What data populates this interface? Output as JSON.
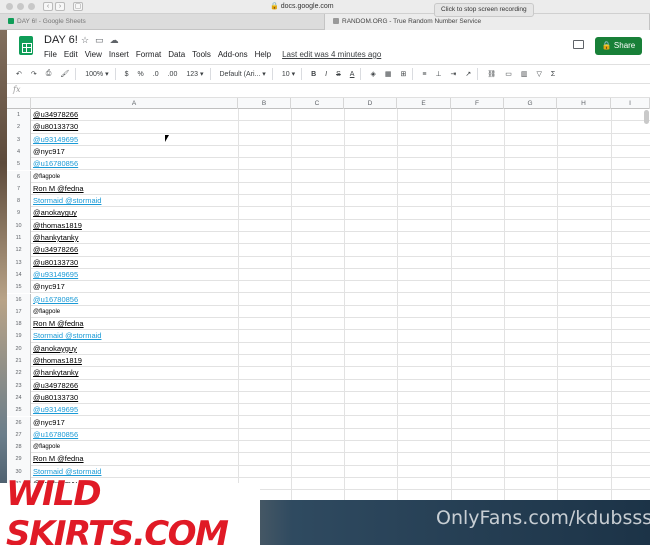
{
  "browser": {
    "url": "docs.google.com",
    "recording_notice": "Click  to stop screen recording",
    "tabs": [
      {
        "label": "DAY 6! - Google Sheets",
        "active": false
      },
      {
        "label": "RANDOM.ORG - True Random Number Service",
        "active": true
      }
    ]
  },
  "sheets": {
    "doc_title": "DAY 6!",
    "menu": [
      "File",
      "Edit",
      "View",
      "Insert",
      "Format",
      "Data",
      "Tools",
      "Add-ons",
      "Help"
    ],
    "last_edit": "Last edit was 4 minutes ago",
    "share_label": "Share",
    "toolbar": {
      "zoom": "100%",
      "currency": "$",
      "percent": "%",
      "dec_decrease": ".0",
      "dec_increase": ".00",
      "more_formats": "123",
      "font": "Default (Ari...",
      "font_size": "10",
      "bold": "B",
      "italic": "I",
      "strike": "S",
      "text_color": "A"
    },
    "fx_label": "fx",
    "columns": [
      "A",
      "B",
      "C",
      "D",
      "E",
      "F",
      "G",
      "H",
      "I"
    ],
    "rows": [
      {
        "n": "1",
        "value": "@u34978266",
        "style": "u"
      },
      {
        "n": "2",
        "value": "@u80133730",
        "style": "u"
      },
      {
        "n": "3",
        "value": "@u93149695",
        "style": "link"
      },
      {
        "n": "4",
        "value": "@nyc917",
        "style": "plain"
      },
      {
        "n": "5",
        "value": "@u16780856",
        "style": "link"
      },
      {
        "n": "6",
        "value": "@flagpole",
        "style": "small"
      },
      {
        "n": "7",
        "value": "Ron M @fedna",
        "style": "u"
      },
      {
        "n": "8",
        "value": "Stormaid @stormaid",
        "style": "link"
      },
      {
        "n": "9",
        "value": "@anokayguy",
        "style": "u"
      },
      {
        "n": "10",
        "value": "@thomas1819",
        "style": "u"
      },
      {
        "n": "11",
        "value": "@hankytanky",
        "style": "u"
      },
      {
        "n": "12",
        "value": "@u34978266",
        "style": "u"
      },
      {
        "n": "13",
        "value": "@u80133730",
        "style": "u"
      },
      {
        "n": "14",
        "value": "@u93149695",
        "style": "link"
      },
      {
        "n": "15",
        "value": "@nyc917",
        "style": "plain"
      },
      {
        "n": "16",
        "value": "@u16780856",
        "style": "link"
      },
      {
        "n": "17",
        "value": "@flagpole",
        "style": "small"
      },
      {
        "n": "18",
        "value": "Ron M @fedna",
        "style": "u"
      },
      {
        "n": "19",
        "value": "Stormaid @stormaid",
        "style": "link"
      },
      {
        "n": "20",
        "value": "@anokayguy",
        "style": "u"
      },
      {
        "n": "21",
        "value": "@thomas1819",
        "style": "u"
      },
      {
        "n": "22",
        "value": "@hankytanky",
        "style": "u"
      },
      {
        "n": "23",
        "value": "@u34978266",
        "style": "u"
      },
      {
        "n": "24",
        "value": "@u80133730",
        "style": "u"
      },
      {
        "n": "25",
        "value": "@u93149695",
        "style": "link"
      },
      {
        "n": "26",
        "value": "@nyc917",
        "style": "plain"
      },
      {
        "n": "27",
        "value": "@u16780856",
        "style": "link"
      },
      {
        "n": "28",
        "value": "@flagpole",
        "style": "small"
      },
      {
        "n": "29",
        "value": "Ron M @fedna",
        "style": "u"
      },
      {
        "n": "30",
        "value": "Stormaid @stormaid",
        "style": "link"
      },
      {
        "n": "31",
        "value": "@anokayguy",
        "style": "u"
      }
    ]
  },
  "watermarks": {
    "left_brand": "WILD SKIRTS.COM",
    "right_text": "OnlyFans.com/kdubsss"
  },
  "colors": {
    "accent_green": "#188038",
    "link_blue": "#1a9ad6",
    "watermark_red": "#e01a26"
  }
}
